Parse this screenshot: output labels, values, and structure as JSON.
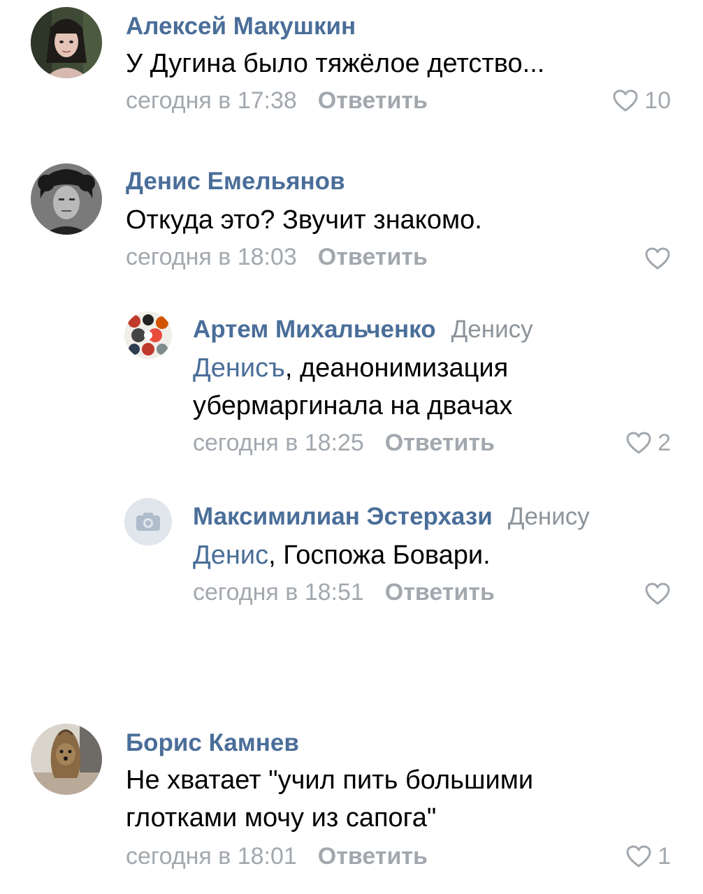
{
  "colors": {
    "author": "#4a6e99",
    "muted": "#a2a8ae",
    "text": "#000000",
    "reply_to": "#8c939a"
  },
  "comments": [
    {
      "author": "Алексей Макушкин",
      "reply_to": "",
      "mention": "",
      "text_lines": [
        "У Дугина было тяжёлое детство..."
      ],
      "time": "сегодня в 17:38",
      "reply_label": "Ответить",
      "likes": "10",
      "avatar_icon": "user-photo-girl"
    },
    {
      "author": "Денис Емельянов",
      "reply_to": "",
      "mention": "",
      "text_lines": [
        "Откуда это? Звучит знакомо."
      ],
      "time": "сегодня в 18:03",
      "reply_label": "Ответить",
      "likes": "",
      "avatar_icon": "user-photo-man-bw"
    },
    {
      "author": "Артем Михальченко",
      "reply_to": "Денису",
      "mention": "Денисъ",
      "text_lines": [
        ", деанонимизация",
        "убермаргинала на двачах"
      ],
      "time": "сегодня в 18:25",
      "reply_label": "Ответить",
      "likes": "2",
      "avatar_icon": "user-photo-collage"
    },
    {
      "author": "Максимилиан Эстерхази",
      "reply_to": "Денису",
      "mention": "Денис",
      "text_lines": [
        ", Госпожа Бовари."
      ],
      "time": "сегодня в 18:51",
      "reply_label": "Ответить",
      "likes": "",
      "avatar_icon": "camera-placeholder-icon"
    },
    {
      "author": "Борис Камнев",
      "reply_to": "",
      "mention": "",
      "text_lines": [
        "Не хватает \"учил пить большими",
        "глотками мочу из сапога\""
      ],
      "time": "сегодня в 18:01",
      "reply_label": "Ответить",
      "likes": "1",
      "avatar_icon": "user-photo-dog"
    }
  ]
}
